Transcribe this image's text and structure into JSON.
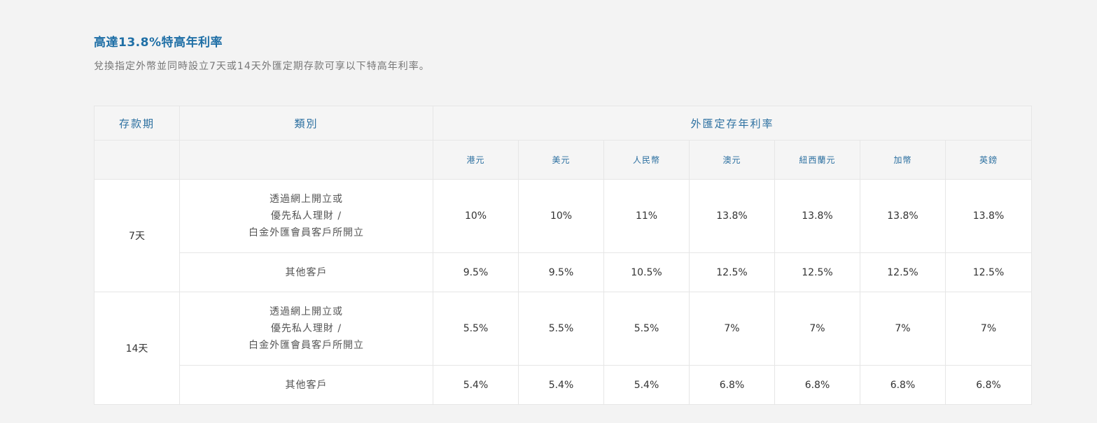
{
  "section": {
    "title": "高達13.8%特高年利率",
    "subtitle": "兌換指定外幣並同時設立7天或14天外匯定期存款可享以下特高年利率。"
  },
  "table": {
    "headers": {
      "period": "存款期",
      "category": "類別",
      "rates_group": "外匯定存年利率"
    },
    "currencies": [
      "港元",
      "美元",
      "人民幣",
      "澳元",
      "紐西蘭元",
      "加幣",
      "英鎊"
    ],
    "groups": [
      {
        "period": "7天",
        "rows": [
          {
            "category_lines": [
              "透過網上開立或",
              "優先私人理財 /",
              "白金外匯會員客戶所開立"
            ],
            "rates": [
              "10%",
              "10%",
              "11%",
              "13.8%",
              "13.8%",
              "13.8%",
              "13.8%"
            ]
          },
          {
            "category_lines": [
              "其他客戶"
            ],
            "rates": [
              "9.5%",
              "9.5%",
              "10.5%",
              "12.5%",
              "12.5%",
              "12.5%",
              "12.5%"
            ]
          }
        ]
      },
      {
        "period": "14天",
        "rows": [
          {
            "category_lines": [
              "透過網上開立或",
              "優先私人理財 /",
              "白金外匯會員客戶所開立"
            ],
            "rates": [
              "5.5%",
              "5.5%",
              "5.5%",
              "7%",
              "7%",
              "7%",
              "7%"
            ]
          },
          {
            "category_lines": [
              "其他客戶"
            ],
            "rates": [
              "5.4%",
              "5.4%",
              "5.4%",
              "6.8%",
              "6.8%",
              "6.8%",
              "6.8%"
            ]
          }
        ]
      }
    ]
  }
}
